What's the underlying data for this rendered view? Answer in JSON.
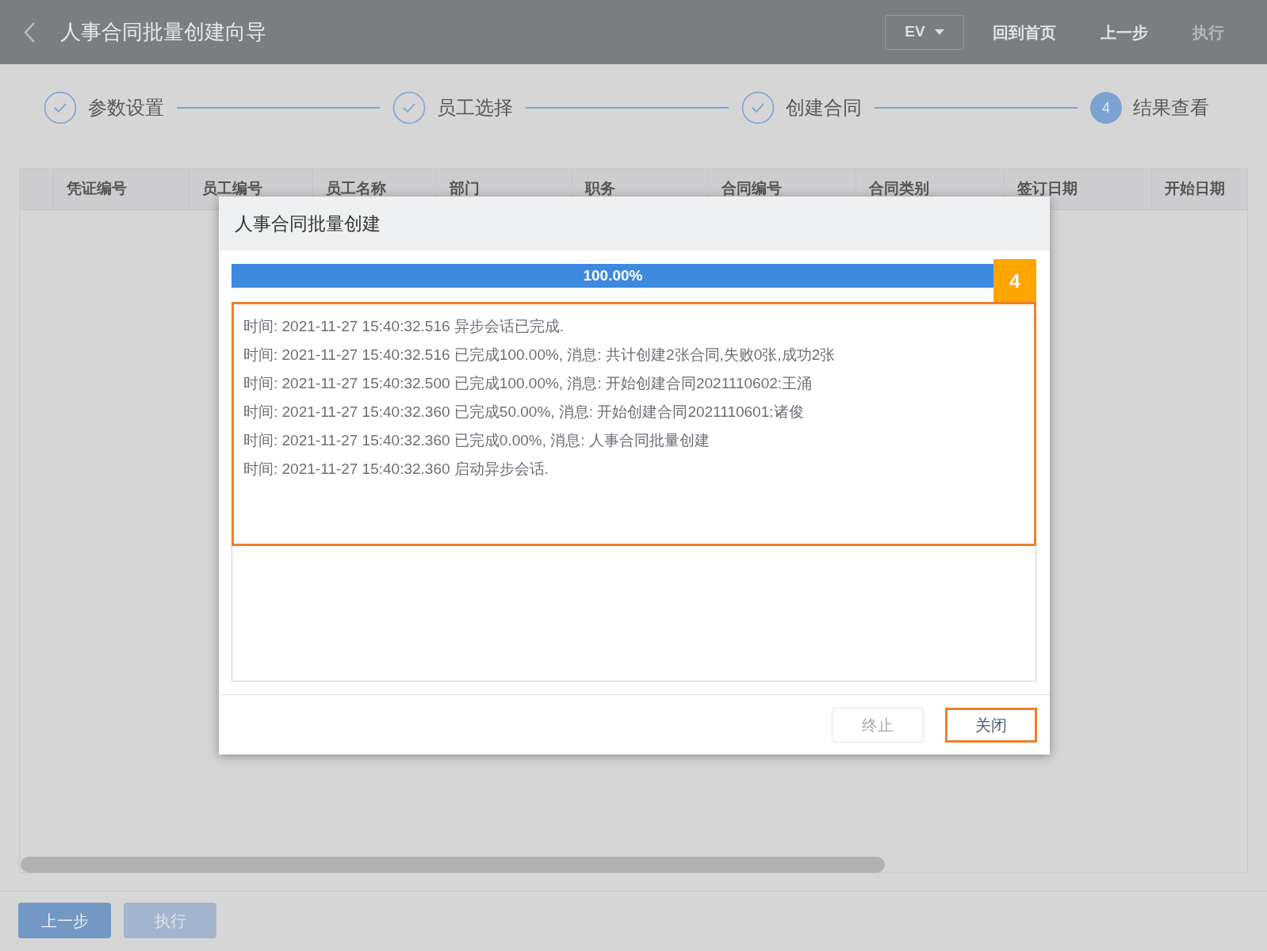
{
  "header": {
    "title": "人事合同批量创建向导",
    "language": "EV",
    "actions": [
      {
        "label": "回到首页",
        "disabled": false
      },
      {
        "label": "上一步",
        "disabled": false
      },
      {
        "label": "执行",
        "disabled": true
      }
    ]
  },
  "steps": [
    {
      "label": "参数设置",
      "completed": true
    },
    {
      "label": "员工选择",
      "completed": true
    },
    {
      "label": "创建合同",
      "completed": true
    },
    {
      "label": "结果查看",
      "completed": false,
      "number": "4"
    }
  ],
  "table": {
    "columns": [
      "凭证编号",
      "员工编号",
      "员工名称",
      "部门",
      "职务",
      "合同编号",
      "合同类别",
      "签订日期",
      "开始日期"
    ]
  },
  "dialog": {
    "title": "人事合同批量创建",
    "progress": {
      "level": 1,
      "label": "100.00%"
    },
    "callout": "4",
    "log_highlighted": true,
    "log": [
      "时间: 2021-11-27 15:40:32.516 异步会话已完成.",
      "时间: 2021-11-27 15:40:32.516 已完成100.00%, 消息: 共计创建2张合同,失败0张,成功2张",
      "时间: 2021-11-27 15:40:32.500 已完成100.00%, 消息: 开始创建合同2021110602:王涌",
      "时间: 2021-11-27 15:40:32.360 已完成50.00%, 消息: 开始创建合同2021110601:诸俊",
      "时间: 2021-11-27 15:40:32.360 已完成0.00%, 消息: 人事合同批量创建",
      "时间: 2021-11-27 15:40:32.360 启动异步会话."
    ],
    "buttons": [
      {
        "label": "终止",
        "disabled": true,
        "highlighted": false
      },
      {
        "label": "关闭",
        "disabled": false,
        "highlighted": true
      }
    ]
  },
  "footer_buttons": [
    {
      "label": "上一步",
      "disabled": false
    },
    {
      "label": "执行",
      "disabled": true
    }
  ]
}
